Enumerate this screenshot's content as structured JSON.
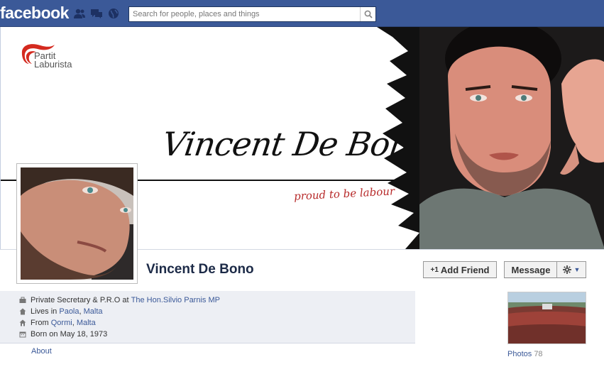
{
  "topbar": {
    "logo": "facebook",
    "search_placeholder": "Search for people, places and things",
    "jewels": [
      "friend-requests-icon",
      "messages-icon",
      "notifications-globe-icon"
    ]
  },
  "cover": {
    "party_logo_line1": "Partit",
    "party_logo_line2": "Laburista",
    "signature": "Vincent De Bono",
    "tagline": "proud to be labour"
  },
  "profile": {
    "name": "Vincent De Bono",
    "add_friend_label": "Add Friend",
    "add_friend_plus": "+1",
    "message_label": "Message"
  },
  "info": {
    "work_prefix": "Private Secretary & P.R.O at ",
    "work_link": "The Hon.Silvio Parnis MP",
    "lives_prefix": "Lives in ",
    "lives_city": "Paola",
    "lives_sep": ", ",
    "lives_country": "Malta",
    "from_prefix": "From ",
    "from_city": "Qormi",
    "from_sep": ", ",
    "from_country": "Malta",
    "born": "Born on May 18, 1973",
    "about_link": "About"
  },
  "photos": {
    "label": "Photos",
    "count": "78"
  },
  "colors": {
    "fb_blue": "#3b5998",
    "info_bg": "#edeff4",
    "tagline_red": "#b72a2a"
  }
}
